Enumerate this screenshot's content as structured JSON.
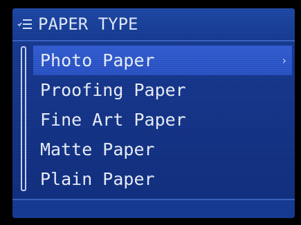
{
  "header": {
    "title": "PAPER TYPE",
    "icon": "menu-list-icon"
  },
  "menu": {
    "items": [
      {
        "label": "Photo Paper",
        "selected": true,
        "has_submenu": true
      },
      {
        "label": "Proofing Paper",
        "selected": false,
        "has_submenu": false
      },
      {
        "label": "Fine Art Paper",
        "selected": false,
        "has_submenu": false
      },
      {
        "label": "Matte Paper",
        "selected": false,
        "has_submenu": false
      },
      {
        "label": "Plain Paper",
        "selected": false,
        "has_submenu": false
      }
    ],
    "chevron": "›"
  },
  "colors": {
    "background": "#15358a",
    "highlight": "#2f5acf",
    "text": "#eef3ff",
    "border": "#3a64c4"
  }
}
